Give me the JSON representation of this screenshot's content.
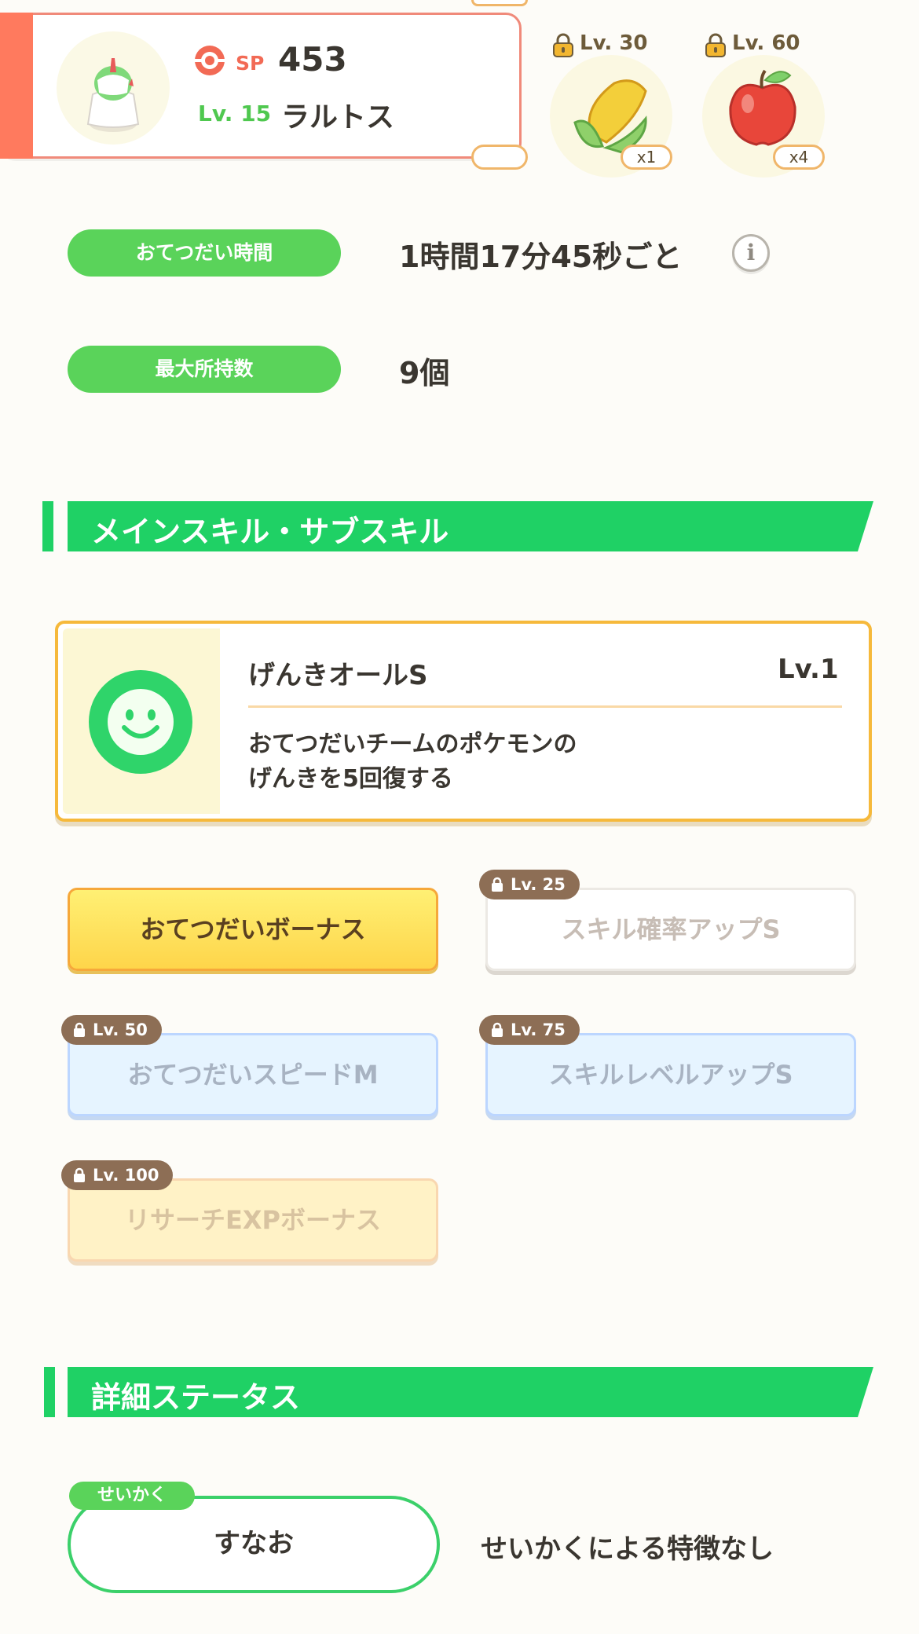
{
  "header": {
    "sp_label": "SP",
    "sp_value": "453",
    "level": "Lv. 15",
    "pokemon_name": "ラルトス",
    "ingredients": [
      {
        "unlock_level": "Lv. 30",
        "quantity": "x1",
        "icon": "corn-icon"
      },
      {
        "unlock_level": "Lv. 60",
        "quantity": "x4",
        "icon": "apple-icon"
      }
    ]
  },
  "info": {
    "help_time_label": "おてつだい時間",
    "help_time_value": "1時間17分45秒ごと",
    "info_button_symbol": "i",
    "max_carry_label": "最大所持数",
    "max_carry_value": "9個"
  },
  "skills_section": {
    "title": "メインスキル・サブスキル",
    "main_skill": {
      "name": "げんきオールS",
      "level": "Lv.1",
      "desc_line1": "おてつだいチームのポケモンの",
      "desc_line2": "げんきを5回復する",
      "icon": "smiley-icon"
    },
    "sub_skills": [
      {
        "name": "おてつだいボーナス",
        "lock": "",
        "state": "active"
      },
      {
        "name": "スキル確率アップS",
        "lock": "Lv. 25",
        "state": "locked"
      },
      {
        "name": "おてつだいスピードM",
        "lock": "Lv. 50",
        "state": "locked"
      },
      {
        "name": "スキルレベルアップS",
        "lock": "Lv. 75",
        "state": "locked"
      },
      {
        "name": "リサーチEXPボーナス",
        "lock": "Lv. 100",
        "state": "locked"
      }
    ]
  },
  "details_section": {
    "title": "詳細ステータス",
    "nature_tag": "せいかく",
    "nature_value": "すなお",
    "nature_desc": "せいかくによる特徴なし"
  },
  "colors": {
    "accent_green": "#1fd165",
    "pill_green": "#5ad35a",
    "card_red": "#ff7a5e",
    "gold_border": "#f6b93b"
  }
}
